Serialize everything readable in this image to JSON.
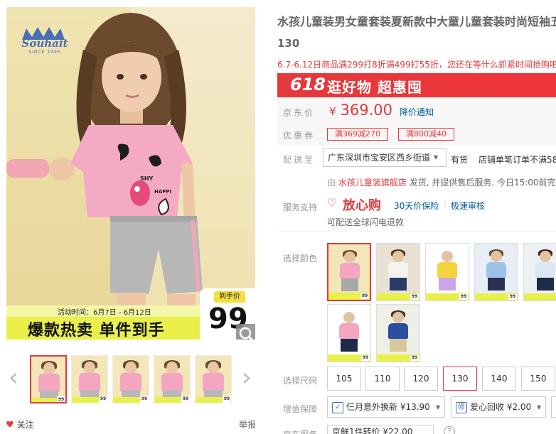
{
  "product": {
    "title": "水孩儿童装男女童套装夏新款中大童儿童套装时尚短袖五",
    "title_line2": "130",
    "promo_text": "6.7-6.12日商品满299打8折满499打55折，您还在等什么抓紧时间抢购吧！",
    "sale_banner": {
      "tag": "618",
      "text": "逛好物 超惠囤"
    },
    "price_label": "京东价",
    "currency": "¥",
    "price": "369.00",
    "price_notice": "降价通知",
    "coupon_label": "优惠券",
    "coupons": [
      "满369减270",
      "满800减40"
    ]
  },
  "main_image": {
    "brand_logo": "Souhait",
    "brand_since": "SINCE 1995",
    "activity_time": "活动时间：6月7日 - 6月12日",
    "banner_text": "爆款热卖  单件到手",
    "badge_label": "到手价",
    "badge_price": "99",
    "shirt_text_1": "SHY",
    "shirt_text_2": "HAPPI"
  },
  "thumbnails": {
    "prev_icon": "chevron-left-icon",
    "next_icon": "chevron-right-icon",
    "count": 5,
    "active_index": 0
  },
  "actions": {
    "follow": "关注",
    "report": "举报"
  },
  "delivery": {
    "label": "配送至",
    "address": "广东深圳市宝安区西乡街道",
    "stock": "有货",
    "shipping": "店铺单笔订单不满58",
    "from_prefix": "由",
    "shop": "水孩儿童装旗舰店",
    "from_suffix": "发货, 并提供售后服务. 今日15:00前完"
  },
  "service": {
    "label": "服务支持",
    "brand": "放心购",
    "item1": "30天价保险",
    "item2": "极速审核",
    "sub": "可配送全球闪电退款"
  },
  "colors": {
    "label": "选择颜色",
    "active_index": 0,
    "swatches": [
      {
        "top": "#f4a6c0",
        "bottom": "#a8a8a8",
        "hair": "#6b4a2e",
        "bg": "#f3e6b8",
        "tag": "99"
      },
      {
        "top": "#f6f2ee",
        "bottom": "#2a3a6a",
        "hair": "#5a3a22",
        "bg": "#e9e1d3",
        "tag": "99"
      },
      {
        "top": "#f4d43a",
        "bottom": "#c9a6e8",
        "hair": "#ffffff",
        "bg": "#ffffff",
        "tag": "99"
      },
      {
        "top": "#9ec3e8",
        "bottom": "#2a3050",
        "hair": "#6b4a2e",
        "bg": "#e8eef6",
        "tag": "99"
      },
      {
        "top": "#dbe7f4",
        "bottom": "#1e2a4a",
        "hair": "#3a2a1e",
        "bg": "#eef1f3",
        "tag": "99"
      },
      {
        "top": "#f4a6c0",
        "bottom": "#1e2a4a",
        "hair": "#ffffff",
        "bg": "#ffffff",
        "tag": "99"
      },
      {
        "top": "#2b4fa0",
        "bottom": "#d6c89a",
        "hair": "#4a3020",
        "bg": "#eef0e8",
        "tag": "99"
      }
    ]
  },
  "sizes": {
    "label": "选择尺码",
    "options": [
      "105",
      "110",
      "120",
      "130",
      "140",
      "150"
    ],
    "active_index": 3
  },
  "value_added": {
    "label": "增值保障",
    "opt1_icon": "✓",
    "opt1": "仨月意外换新 ¥13.90",
    "opt2_icon": "修",
    "opt2": "爱心回收 ¥2.00"
  },
  "jd_service": {
    "label": "京东服务",
    "text": "京鲜1件转价 ¥22.00",
    "help": "?"
  }
}
